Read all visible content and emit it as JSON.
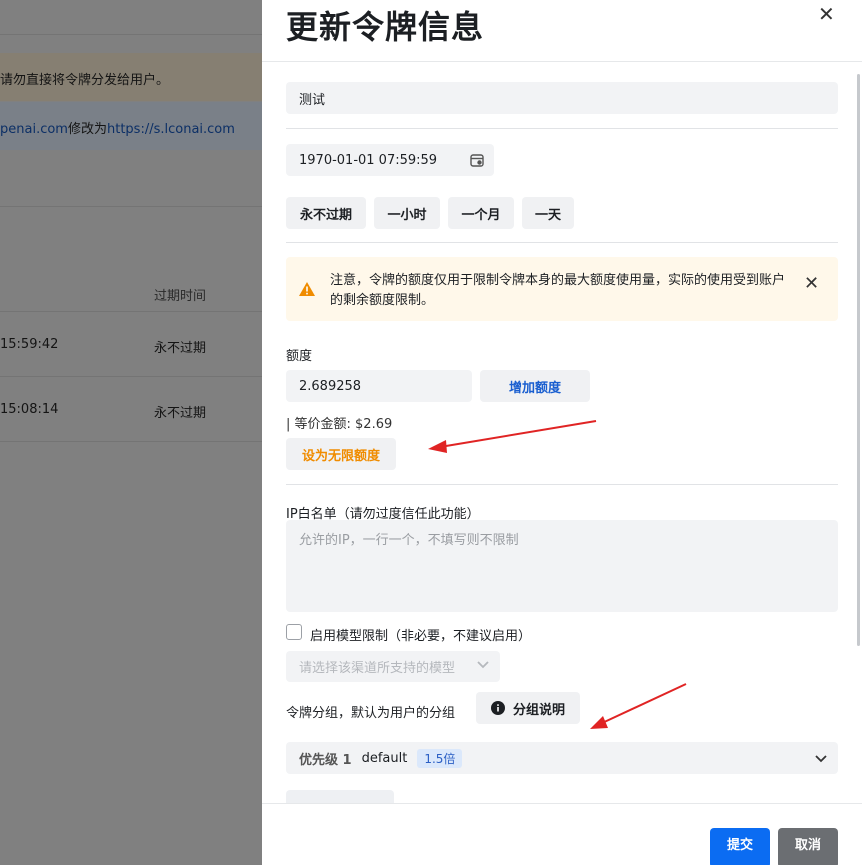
{
  "background": {
    "warning_text": "请勿直接将令牌分发给用户。",
    "info_domain_from": "penai.com",
    "info_middle": "修改为",
    "info_domain_to": "https://s.lconai.com",
    "col_header_expire": "过期时间",
    "rows": [
      {
        "time": "15:59:42",
        "expire": "永不过期"
      },
      {
        "time": "15:08:14",
        "expire": "永不过期"
      }
    ]
  },
  "drawer": {
    "title": "更新令牌信息",
    "name_value": "测试",
    "expire_value": "1970-01-01 07:59:59",
    "quick_expire": [
      "永不过期",
      "一小时",
      "一个月",
      "一天"
    ],
    "alert_text": "注意，令牌的额度仅用于限制令牌本身的最大额度使用量，实际的使用受到账户的剩余额度限制。",
    "quota_label": "额度",
    "quota_value": "2.689258",
    "add_quota_label": "增加额度",
    "equivalent_text": "| 等价金额: $2.69",
    "unlimited_label": "设为无限额度",
    "ip_label": "IP白名单（请勿过度信任此功能）",
    "ip_placeholder": "允许的IP，一行一个，不填写则不限制",
    "model_limit_label": "启用模型限制（非必要，不建议启用）",
    "model_select_placeholder": "请选择该渠道所支持的模型",
    "group_label": "令牌分组，默认为用户的分组",
    "group_help_label": "分组说明",
    "group_priority": "优先级 1",
    "group_name": "default",
    "group_ratio": "1.5倍",
    "submit_label": "提交",
    "cancel_label": "取消"
  },
  "colors": {
    "primary": "#0b6cf2",
    "warning_accent": "#f08c00",
    "annotation_arrow": "#e02424"
  }
}
